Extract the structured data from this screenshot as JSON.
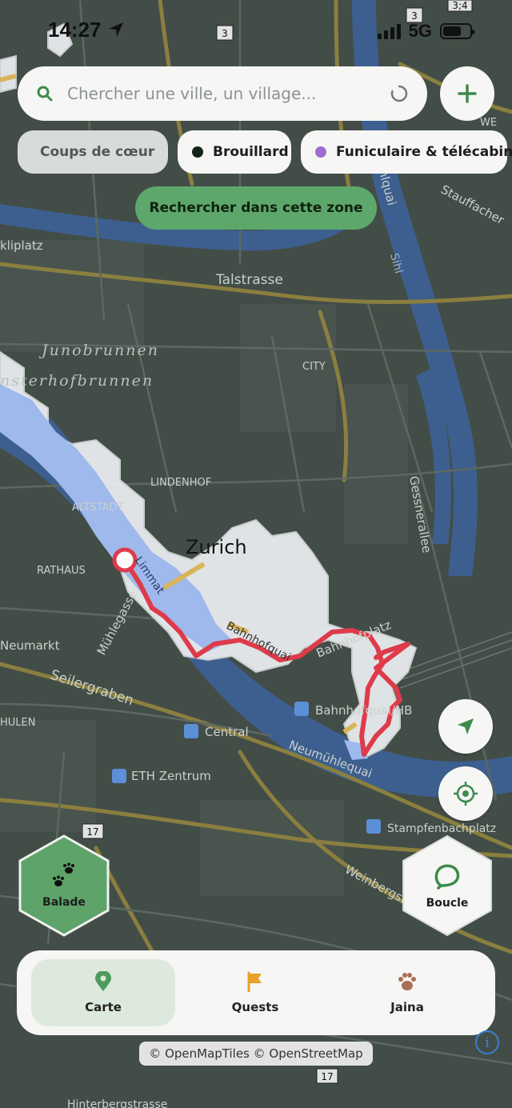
{
  "status_bar": {
    "time": "14:27",
    "network": "5G"
  },
  "search": {
    "placeholder": "Chercher une ville, un village..."
  },
  "filters": [
    {
      "label": "Coups de cœur",
      "color": "#d4595f"
    },
    {
      "label": "Brouillard",
      "color": "#12231a"
    },
    {
      "label": "Funiculaire & télécabine",
      "color": "#9b6fd1"
    }
  ],
  "search_zone_label": "Rechercher dans cette zone",
  "modes": {
    "left": {
      "label": "Balade",
      "icon": "paw-prints-icon"
    },
    "right": {
      "label": "Boucle",
      "icon": "loop-icon"
    }
  },
  "nav": [
    {
      "label": "Carte",
      "icon": "map-pin-icon",
      "active": true
    },
    {
      "label": "Quests",
      "icon": "flag-icon",
      "active": false
    },
    {
      "label": "Jaina",
      "icon": "paw-icon",
      "active": false
    }
  ],
  "attribution": "© OpenMapTiles © OpenStreetMap",
  "map_labels": {
    "city": "Zurich",
    "junobrunnen": "Junobrunnen",
    "munsterhofbrunnen": "nsterhofbrunnen",
    "lindenhof": "LINDENHOF",
    "altstadt": "ALTSTADT",
    "rathaus": "RATHAUS",
    "city_district": "CITY",
    "talstrasse": "Talstrasse",
    "seilergraben": "Seilergraben",
    "muehlegasse": "Mühlegasse",
    "neumarkt": "Neumarkt",
    "hulen": "HULEN",
    "limmat": "Limmat",
    "bahnhofquai": "Bahnhofquai",
    "bahnhofplatz": "Bahnhofplatz",
    "bahnhofquai_hb": "Bahnhofquai/HB",
    "central": "Central",
    "eth_zentrum": "ETH Zentrum",
    "neumuehlequai": "Neumühlequai",
    "stampfenbachplatz": "Stampfenbachplatz",
    "weinbergstrasse": "Weinbergstrasse",
    "gessnerallee": "Gessnerallee",
    "sihlquai": "Sihlquai",
    "sihl": "Sihl",
    "stauffacher": "Stauffacher",
    "kliplatz": "kliplatz",
    "route3a": "3",
    "route3b": "3",
    "route34": "3;4",
    "route17a": "17",
    "route17b": "17",
    "hinterberg": "Hinterbergstrasse",
    "we": "WE"
  }
}
